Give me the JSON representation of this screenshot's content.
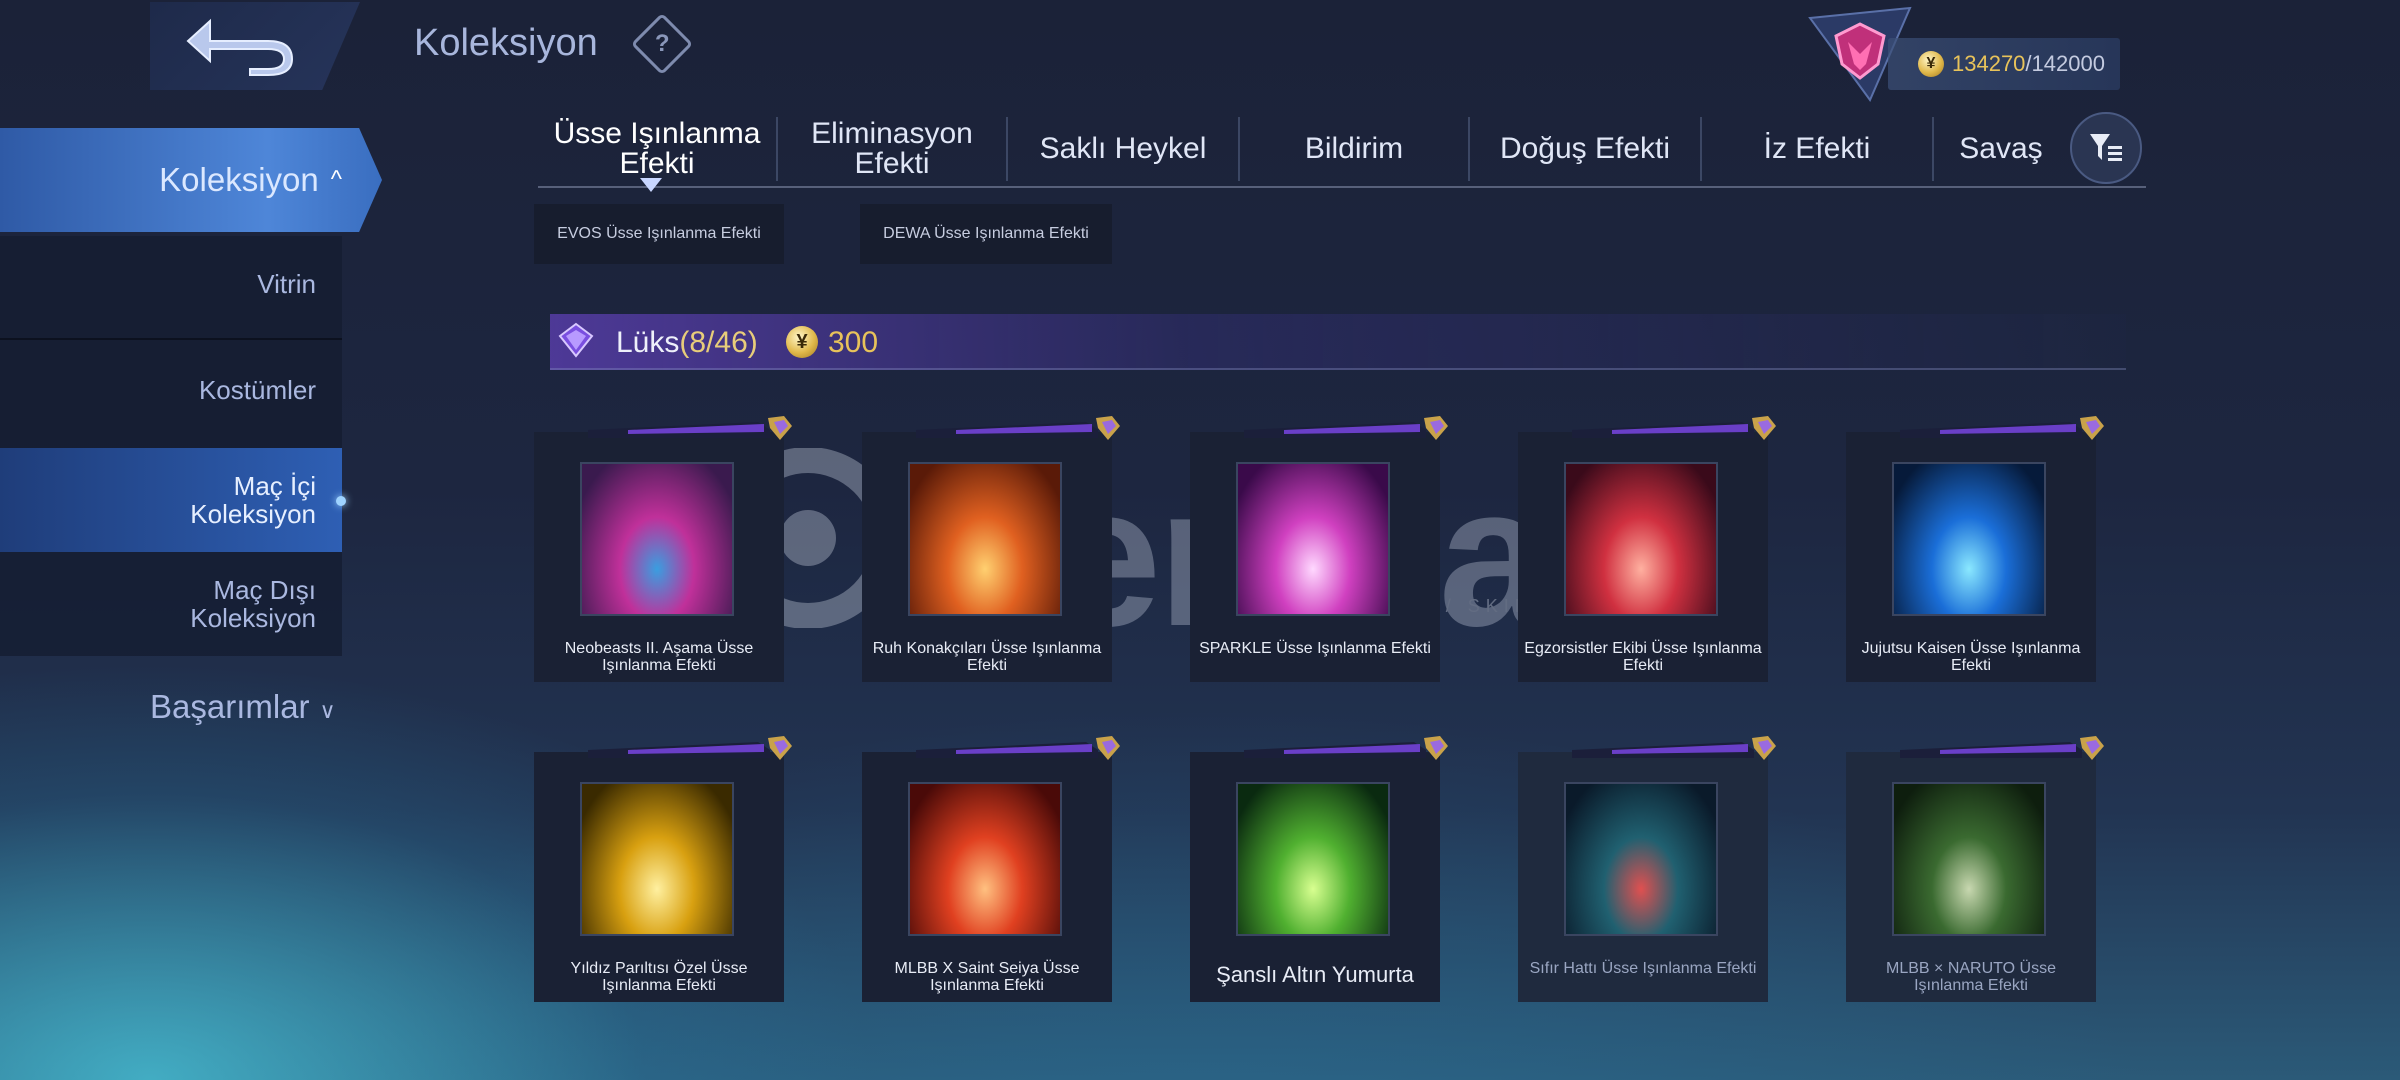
{
  "header": {
    "title": "Koleksiyon",
    "help_icon": "?",
    "currency_current": "134270",
    "currency_max": "/142000"
  },
  "sidebar": {
    "main_label": "Koleksiyon",
    "items": [
      {
        "label": "Vitrin"
      },
      {
        "label": "Kostümler"
      },
      {
        "label": "Maç İçi Koleksiyon"
      },
      {
        "label": "Maç Dışı Koleksiyon"
      }
    ],
    "achievements_label": "Başarımlar"
  },
  "tabs": [
    {
      "label": "Üsse Işınlanma Efekti"
    },
    {
      "label": "Eliminasyon Efekti"
    },
    {
      "label": "Saklı Heykel"
    },
    {
      "label": "Bildirim"
    },
    {
      "label": "Doğuş Efekti"
    },
    {
      "label": "İz Efekti"
    },
    {
      "label": "Savaş"
    }
  ],
  "subtabs": [
    {
      "label": "EVOS Üsse Işınlanma Efekti"
    },
    {
      "label": "DEWA Üsse Işınlanma Efekti"
    }
  ],
  "section": {
    "title": "Lüks",
    "count": "(8/46)",
    "price": "300"
  },
  "items": [
    {
      "name": "Neobeasts II. Aşama Üsse Işınlanma Efekti"
    },
    {
      "name": "Ruh Konakçıları Üsse Işınlanma Efekti"
    },
    {
      "name": "SPARKLE Üsse Işınlanma Efekti"
    },
    {
      "name": "Egzorsistler Ekibi Üsse Işınlanma Efekti"
    },
    {
      "name": "Jujutsu Kaisen Üsse Işınlanma Efekti"
    },
    {
      "name": "Yıldız Parıltısı Özel Üsse Işınlanma Efekti"
    },
    {
      "name": "MLBB X Saint Seiya Üsse Işınlanma Efekti"
    },
    {
      "name": "Şanslı Altın Yumurta"
    },
    {
      "name": "Sıfır Hattı Üsse Işınlanma Efekti"
    },
    {
      "name": "MLBB × NARUTO Üsse Işınlanma Efekti"
    }
  ],
  "watermark": {
    "brand": "itemsatış",
    "tagline": "HESAP / SKIN / ITEM / E-PIN",
    "domain": ".com"
  },
  "colors": {
    "accent_gold": "#e8c35a",
    "accent_purple": "#7a4fe0",
    "sidebar_active": "#4e86d8"
  }
}
